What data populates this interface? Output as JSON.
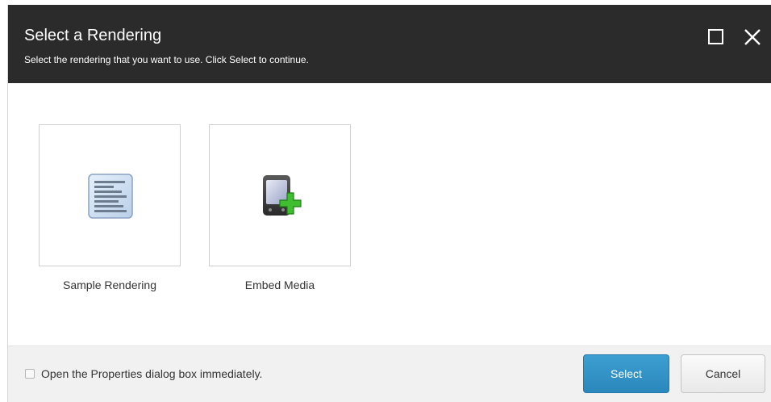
{
  "dialog": {
    "title": "Select a Rendering",
    "subtitle": "Select the rendering that you want to use. Click Select to continue.",
    "maximize_icon": "maximize-icon",
    "close_icon": "close-icon"
  },
  "renderings": [
    {
      "label": "Sample Rendering",
      "icon": "document-lines-icon",
      "selected": false
    },
    {
      "label": "Embed Media",
      "icon": "device-add-icon",
      "selected": false
    }
  ],
  "footer": {
    "checkbox_label": "Open the Properties dialog box immediately.",
    "checkbox_checked": false,
    "select_label": "Select",
    "cancel_label": "Cancel"
  },
  "colors": {
    "header_bg": "#2b2b2b",
    "footer_bg": "#f1f1f1",
    "primary_button": "#2b87bc"
  }
}
